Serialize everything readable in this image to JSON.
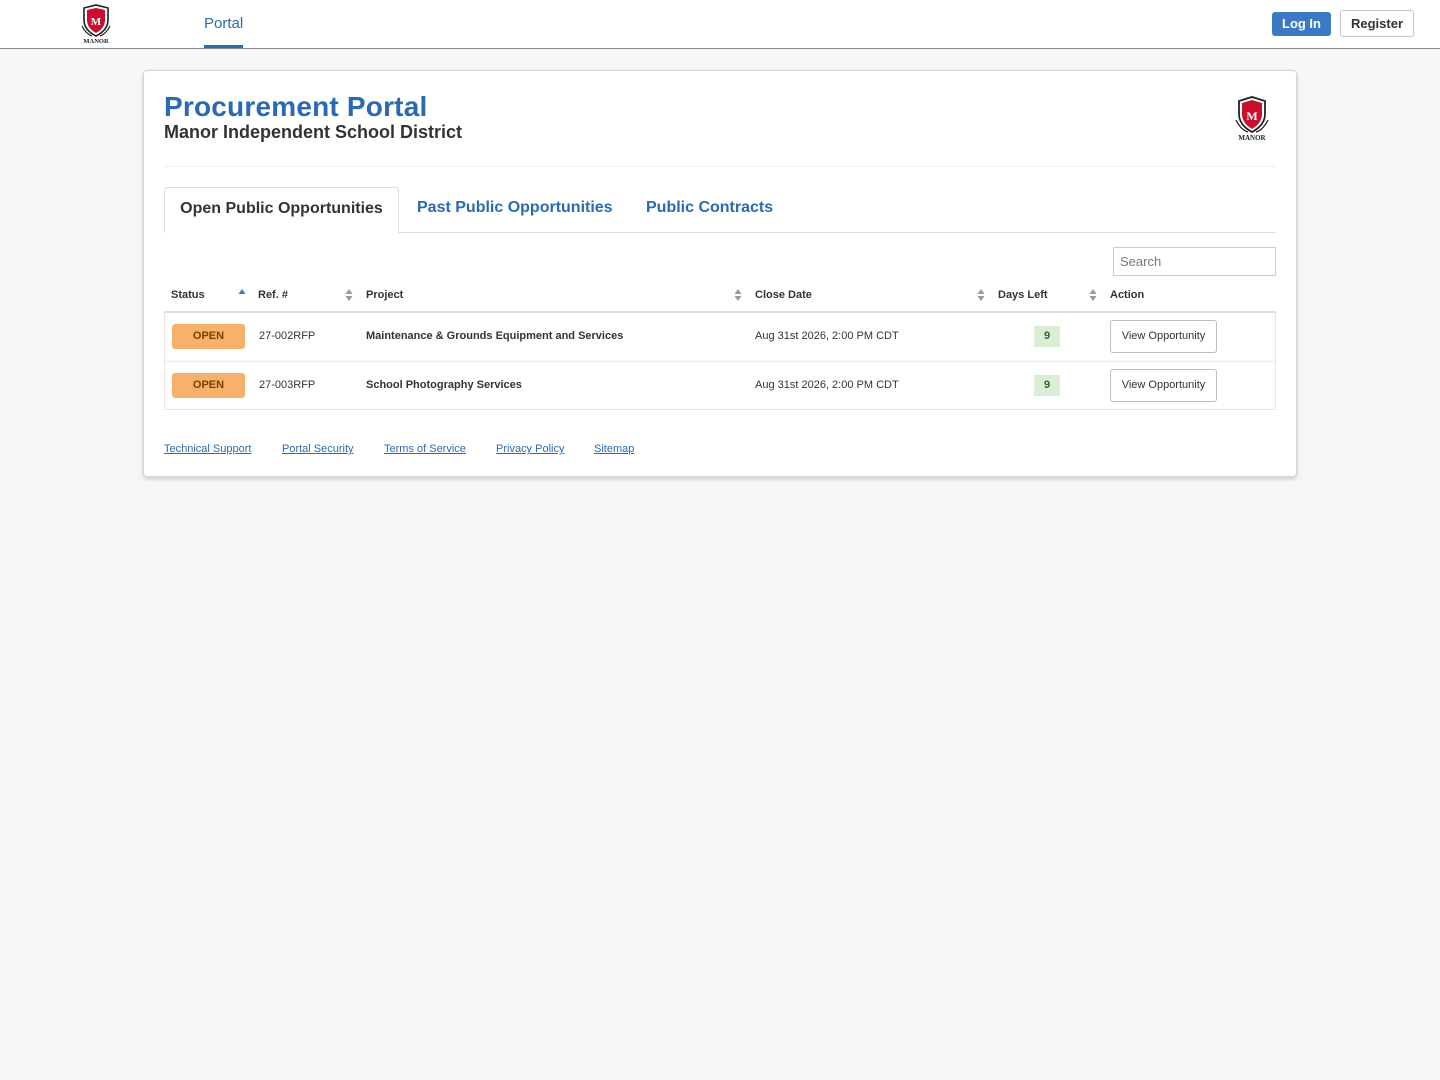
{
  "nav": {
    "portal_label": "Portal",
    "login_label": "Log In",
    "register_label": "Register"
  },
  "header": {
    "title": "Procurement Portal",
    "subtitle": "Manor Independent School District",
    "logo_text": "MANOR",
    "logo_letter": "M"
  },
  "tabs": [
    {
      "label": "Open Public Opportunities",
      "active": true
    },
    {
      "label": "Past Public Opportunities",
      "active": false
    },
    {
      "label": "Public Contracts",
      "active": false
    }
  ],
  "search": {
    "placeholder": "Search",
    "value": ""
  },
  "table": {
    "columns": [
      "Status",
      "Ref. #",
      "Project",
      "Close Date",
      "Days Left",
      "Action"
    ],
    "sort": {
      "column": "Status",
      "direction": "ascending"
    },
    "rows": [
      {
        "status": "OPEN",
        "ref": "27-002RFP",
        "project": "Maintenance & Grounds Equipment and Services",
        "close_date": "Aug 31st 2026, 2:00 PM CDT",
        "days_left": "9",
        "action": "View Opportunity"
      },
      {
        "status": "OPEN",
        "ref": "27-003RFP",
        "project": "School Photography Services",
        "close_date": "Aug 31st 2026, 2:00 PM CDT",
        "days_left": "9",
        "action": "View Opportunity"
      }
    ]
  },
  "footer": {
    "links": [
      "Technical Support",
      "Portal Security",
      "Terms of Service",
      "Privacy Policy",
      "Sitemap"
    ]
  },
  "colors": {
    "brand_blue": "#2a6ab1",
    "login_blue": "#3d78c4",
    "status_open": "#f6b26b",
    "days_badge": "#dcedd6",
    "logo_red": "#c8102e"
  }
}
